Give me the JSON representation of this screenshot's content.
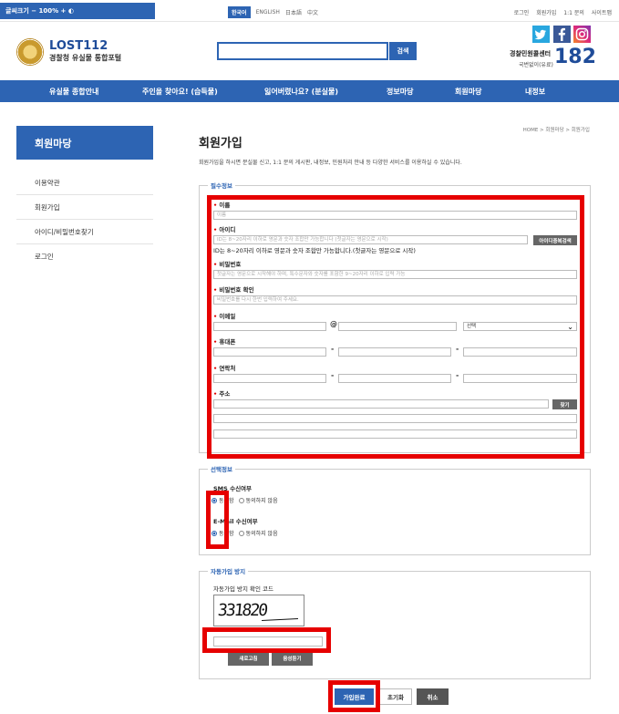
{
  "topbar": {
    "accessibility": "글씨크기  −  100%  +  ◐",
    "languages": [
      "한국어",
      "ENGLISH",
      "日本語",
      "中文"
    ],
    "links": [
      "로그인",
      "회원가입",
      "1:1 문의",
      "사이트맵"
    ]
  },
  "header": {
    "logo_title": "LOST112",
    "logo_sub": "경찰청 유실물 통합포털",
    "search_button": "검색",
    "search_placeholder": "",
    "cs_title": "경찰민원콜센터",
    "cs_sub": "국번없이(유료)",
    "cs_number": "182"
  },
  "nav": [
    "유실물 종합안내",
    "주인을 찾아요! (습득물)",
    "잃어버렸나요? (분실물)",
    "정보마당",
    "회원마당",
    "내정보"
  ],
  "sidebar": {
    "title": "회원마당",
    "items": [
      "이용약관",
      "회원가입",
      "아이디/비밀번호찾기",
      "로그인"
    ]
  },
  "page": {
    "title": "회원가입",
    "breadcrumb": "HOME > 회원마당 > 회원가입",
    "intro": "회원가입을 하시면 분실물 신고, 1:1 문의 게시판, 내정보, 민원처리 안내 등 다양한 서비스를 이용하실 수 있습니다."
  },
  "required": {
    "legend": "필수정보",
    "name_label": "이름",
    "name_placeholder": "이름",
    "id_label": "아이디",
    "id_placeholder": "ID는 8~20자리 이하로 영문과 숫자 조합만 가능합니다 (첫글자는 영문으로 시작)",
    "id_check_button": "아이디중복검색",
    "id_note": "ID는 8~20자리 이하로 영문과 숫자 조합만 가능합니다.(첫글자는 영문으로 시작)",
    "pw_label": "비밀번호",
    "pw_placeholder": "첫글자는 영문으로 시작해야 하며, 특수문자와 숫자를 포함한 9~20자리 이하로 입력 가능",
    "pw_confirm_label": "비밀번호 확인",
    "pw_confirm_placeholder": "비밀번호를 다시 한번 입력하여 주세요.",
    "email_label": "이메일",
    "email_at": "@",
    "email_select": "선택",
    "mobile_label": "휴대폰",
    "phone_label": "연락처",
    "dash": "-",
    "address_label": "주소",
    "address_button": "찾기"
  },
  "optional": {
    "legend": "선택정보",
    "sms_label": "SMS 수신여부",
    "email_label": "E-Mail 수신여부",
    "agree": "동의함",
    "disagree": "동의하지 않음"
  },
  "captcha": {
    "legend": "자동가입 방지",
    "label": "자동가입 방지 확인 코드",
    "code": "331820",
    "refresh_button": "새로고침",
    "audio_button": "음성듣기"
  },
  "actions": {
    "submit": "가입완료",
    "reset": "초기화",
    "cancel": "취소"
  },
  "colors": {
    "brand_blue": "#2d64b3",
    "highlight_red": "#e60000"
  }
}
